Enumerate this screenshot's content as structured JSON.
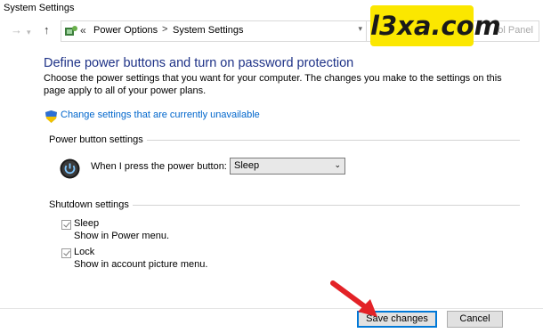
{
  "window": {
    "title": "System Settings"
  },
  "nav": {
    "back_icon": "arrow-left-icon",
    "forward_icon": "chevron-down-icon",
    "up_icon": "arrow-up-icon",
    "address_prefix": "«",
    "breadcrumb": [
      "Power Options",
      "System Settings"
    ],
    "breadcrumb_separator": ">",
    "search_placeholder": "ol Panel"
  },
  "watermark": {
    "text": "l3xa.com",
    "bg_color": "#fbe700"
  },
  "content": {
    "heading": "Define power buttons and turn on password protection",
    "description": "Choose the power settings that you want for your computer. The changes you make to the settings on this page apply to all of your power plans.",
    "change_link": "Change settings that are currently unavailable",
    "power_group": {
      "label": "Power button settings",
      "field_label": "When I press the power button:",
      "selected": "Sleep"
    },
    "shutdown_group": {
      "label": "Shutdown settings",
      "items": [
        {
          "label": "Sleep",
          "sub": "Show in Power menu.",
          "checked": true
        },
        {
          "label": "Lock",
          "sub": "Show in account picture menu.",
          "checked": true
        }
      ]
    }
  },
  "footer": {
    "save_label": "Save changes",
    "cancel_label": "Cancel"
  },
  "colors": {
    "heading": "#1e3287",
    "link": "#0066cc",
    "accent": "#0078d7",
    "arrow": "#e32227"
  }
}
